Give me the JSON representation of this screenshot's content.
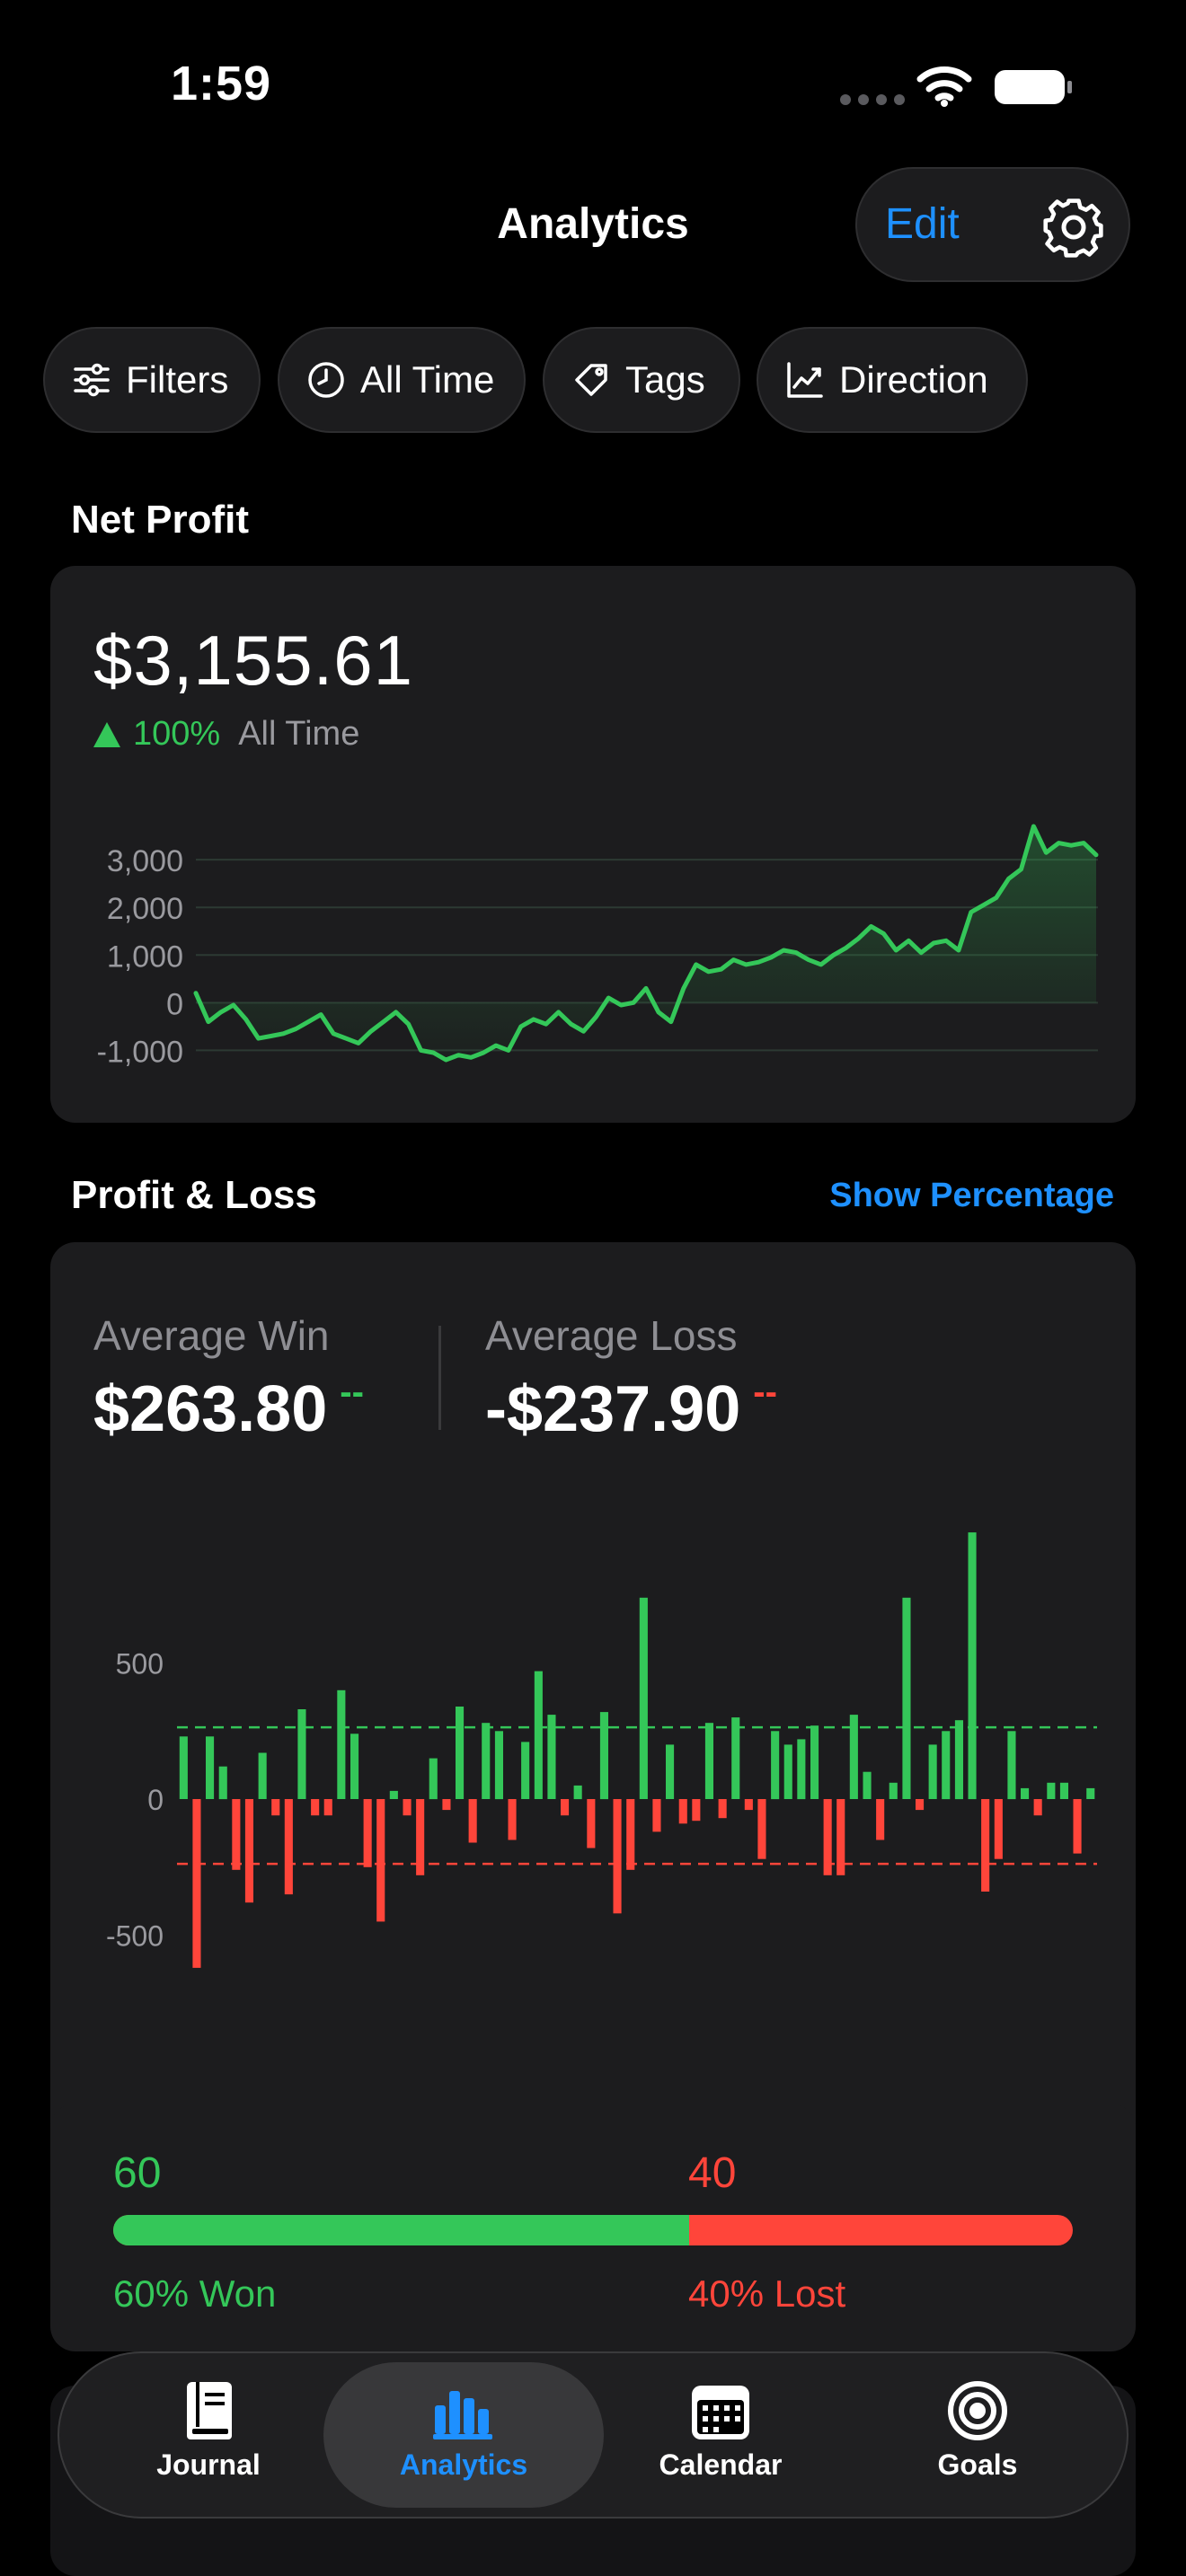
{
  "status": {
    "time": "1:59"
  },
  "header": {
    "title": "Analytics",
    "edit_label": "Edit"
  },
  "filters": [
    {
      "label": "Filters",
      "icon": "sliders-icon"
    },
    {
      "label": "All Time",
      "icon": "clock-icon"
    },
    {
      "label": "Tags",
      "icon": "tag-icon"
    },
    {
      "label": "Direction",
      "icon": "trend-chart-icon"
    }
  ],
  "net_profit": {
    "section_title": "Net Profit",
    "value": "$3,155.61",
    "change_pct": "100%",
    "period": "All Time"
  },
  "profit_loss": {
    "section_title": "Profit & Loss",
    "show_percentage_label": "Show Percentage",
    "avg_win_label": "Average Win",
    "avg_win_value": "$263.80",
    "avg_win_indicator": "--",
    "avg_loss_label": "Average Loss",
    "avg_loss_value": "-$237.90",
    "avg_loss_indicator": "--"
  },
  "win_loss": {
    "won_count": "60",
    "lost_count": "40",
    "won_label": "60% Won",
    "lost_label": "40% Lost",
    "won_fraction": 0.6
  },
  "tabs": [
    {
      "label": "Journal",
      "icon": "book-icon",
      "active": false
    },
    {
      "label": "Analytics",
      "icon": "bar-chart-icon",
      "active": true
    },
    {
      "label": "Calendar",
      "icon": "calendar-icon",
      "active": false
    },
    {
      "label": "Goals",
      "icon": "target-icon",
      "active": false
    }
  ],
  "colors": {
    "accent": "#1e90ff",
    "profit": "#34c759",
    "loss": "#ff453a",
    "card": "#1c1c1e"
  },
  "chart_data": [
    {
      "type": "area",
      "title": "",
      "yticks": [
        "3,000",
        "2,000",
        "1,000",
        "0",
        "-1,000"
      ],
      "ylim": [
        -1200,
        3700
      ],
      "grid": true,
      "series": [
        {
          "values": [
            200,
            -400,
            -200,
            -50,
            -350,
            -750,
            -700,
            -650,
            -550,
            -400,
            -250,
            -650,
            -750,
            -850,
            -600,
            -400,
            -200,
            -450,
            -1000,
            -1050,
            -1200,
            -1100,
            -1150,
            -1050,
            -900,
            -1000,
            -500,
            -350,
            -450,
            -200,
            -450,
            -600,
            -300,
            100,
            -50,
            0,
            300,
            -200,
            -400,
            300,
            800,
            650,
            700,
            900,
            800,
            850,
            950,
            1100,
            1050,
            900,
            800,
            1000,
            1150,
            1350,
            1600,
            1450,
            1100,
            1300,
            1050,
            1250,
            1300,
            1100,
            1900,
            2050,
            2200,
            2600,
            2800,
            3700,
            3150,
            3350,
            3300,
            3350,
            3100
          ]
        }
      ]
    },
    {
      "type": "bar",
      "title": "",
      "yticks": [
        "500",
        "0",
        "-500"
      ],
      "ylim": [
        -650,
        1000
      ],
      "reference_lines": [
        263.8,
        -237.9
      ],
      "series": [
        {
          "values": [
            230,
            -620,
            230,
            120,
            -260,
            -380,
            170,
            -60,
            -350,
            330,
            -60,
            -60,
            400,
            240,
            -250,
            -450,
            30,
            -60,
            -280,
            150,
            -40,
            340,
            -160,
            280,
            250,
            -150,
            210,
            470,
            310,
            -60,
            50,
            -180,
            320,
            -420,
            -260,
            740,
            -120,
            200,
            -90,
            -80,
            280,
            -70,
            300,
            -40,
            -220,
            250,
            200,
            220,
            270,
            -280,
            -280,
            310,
            100,
            -150,
            60,
            740,
            -40,
            200,
            250,
            290,
            980,
            -340,
            -220,
            250,
            40,
            -60,
            60,
            60,
            -200,
            40
          ]
        }
      ]
    }
  ]
}
